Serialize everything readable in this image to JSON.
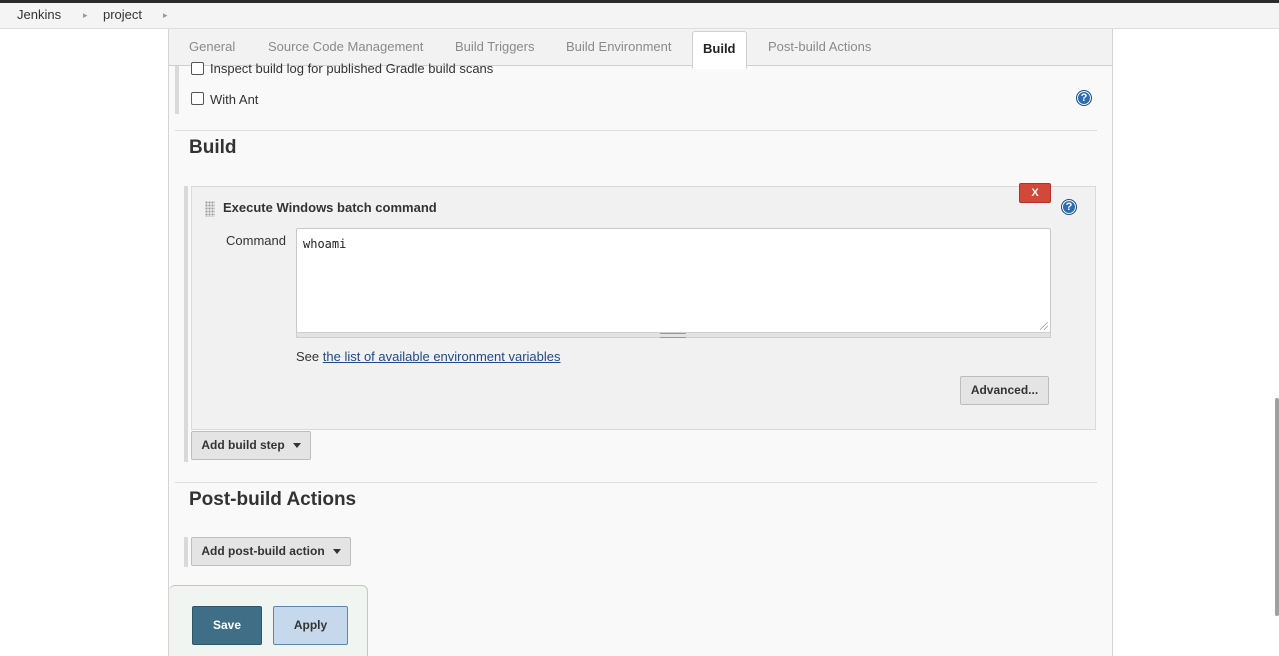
{
  "breadcrumb": {
    "items": [
      "Jenkins",
      "project"
    ],
    "separator": "▸"
  },
  "tabs": [
    {
      "label": "General",
      "active": false
    },
    {
      "label": "Source Code Management",
      "active": false
    },
    {
      "label": "Build Triggers",
      "active": false
    },
    {
      "label": "Build Environment",
      "active": false
    },
    {
      "label": "Build",
      "active": true
    },
    {
      "label": "Post-build Actions",
      "active": false
    }
  ],
  "build_environment": {
    "options": [
      {
        "label": "Inspect build log for published Gradle build scans",
        "checked": false
      },
      {
        "label": "With Ant",
        "checked": false
      }
    ],
    "help_icon": "question-circle-icon"
  },
  "build_section": {
    "title": "Build",
    "step": {
      "title": "Execute Windows batch command",
      "delete_label": "X",
      "command_label": "Command",
      "command_value": "whoami",
      "see_text": "See",
      "env_link_text": "the list of available environment variables",
      "advanced_label": "Advanced..."
    },
    "add_step_label": "Add build step"
  },
  "post_build": {
    "title": "Post-build Actions",
    "add_action_label": "Add post-build action"
  },
  "footer_buttons": {
    "save_label": "Save",
    "apply_label": "Apply"
  },
  "colors": {
    "accent_save": "#3e6f87",
    "delete_red": "#d24939",
    "help_blue": "#2f6db3",
    "link_blue": "#204a87"
  }
}
